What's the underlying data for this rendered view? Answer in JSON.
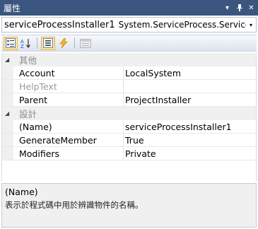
{
  "window": {
    "title": "屬性",
    "dropdown_glyph": "▾",
    "pin_glyph": "ᚹ",
    "close_glyph": "✕"
  },
  "selector": {
    "object_name": "serviceProcessInstaller1",
    "object_type": "System.ServiceProcess.ServiceProce",
    "arrow": "▾"
  },
  "toolbar": {
    "buttons": [
      {
        "name": "categorized",
        "pressed": true
      },
      {
        "name": "alphabetical",
        "pressed": false
      },
      {
        "name": "properties",
        "pressed": true
      },
      {
        "name": "events",
        "pressed": false
      },
      {
        "name": "property-pages",
        "disabled": true
      }
    ]
  },
  "grid": {
    "cat1": {
      "label": "其他",
      "caret": "◢"
    },
    "cat1_props": [
      {
        "name": "Account",
        "value": "LocalSystem",
        "dim": false
      },
      {
        "name": "HelpText",
        "value": "",
        "dim": true
      },
      {
        "name": "Parent",
        "value": "ProjectInstaller",
        "dim": false
      }
    ],
    "cat2": {
      "label": "設計",
      "caret": "◢"
    },
    "cat2_props": [
      {
        "name": "(Name)",
        "value": "serviceProcessInstaller1",
        "dim": false
      },
      {
        "name": "GenerateMember",
        "value": "True",
        "dim": false
      },
      {
        "name": "Modifiers",
        "value": "Private",
        "dim": false
      }
    ]
  },
  "help": {
    "title": "(Name)",
    "description": "表示於程式碼中用於辨識物件的名稱。"
  },
  "colors": {
    "titlebar": "#3a567e",
    "pressed_button": "#ffe9a6",
    "category_text": "#8a8a8a"
  }
}
